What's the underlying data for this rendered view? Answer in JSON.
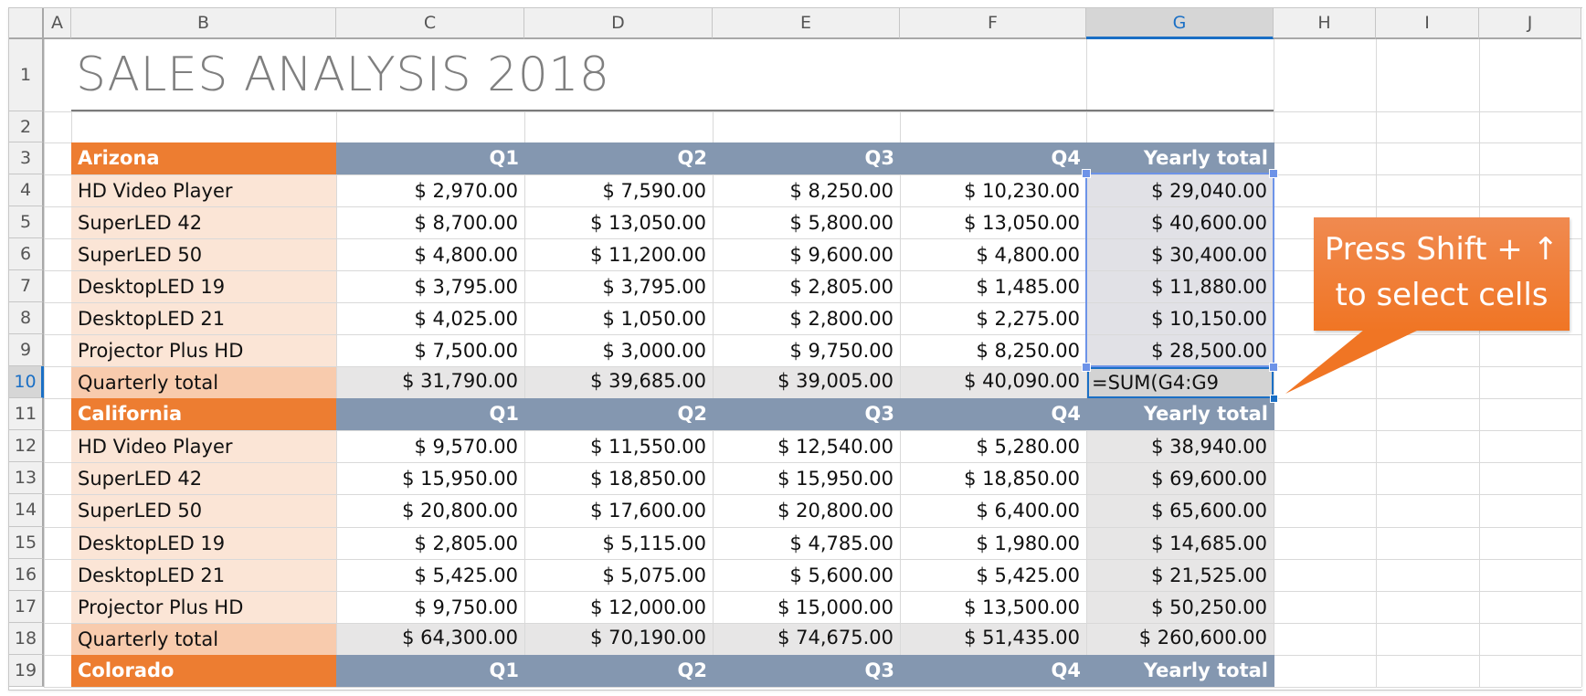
{
  "columns": [
    "A",
    "B",
    "C",
    "D",
    "E",
    "F",
    "G",
    "H",
    "I",
    "J"
  ],
  "selected_column": "G",
  "rows": [
    "1",
    "2",
    "3",
    "4",
    "5",
    "6",
    "7",
    "8",
    "9",
    "10",
    "11",
    "12",
    "13",
    "14",
    "15",
    "16",
    "17",
    "18",
    "19"
  ],
  "selected_row": "10",
  "title": "SALES ANALYSIS 2018",
  "quarter_headers": [
    "Q1",
    "Q2",
    "Q3",
    "Q4",
    "Yearly total"
  ],
  "sections": [
    {
      "state": "Arizona",
      "products": [
        {
          "name": "HD Video Player",
          "values": [
            "$ 2,970.00",
            "$ 7,590.00",
            "$ 8,250.00",
            "$ 10,230.00",
            "$ 29,040.00"
          ]
        },
        {
          "name": "SuperLED 42",
          "values": [
            "$ 8,700.00",
            "$ 13,050.00",
            "$ 5,800.00",
            "$ 13,050.00",
            "$ 40,600.00"
          ]
        },
        {
          "name": "SuperLED 50",
          "values": [
            "$ 4,800.00",
            "$ 11,200.00",
            "$ 9,600.00",
            "$ 4,800.00",
            "$ 30,400.00"
          ]
        },
        {
          "name": "DesktopLED 19",
          "values": [
            "$ 3,795.00",
            "$ 3,795.00",
            "$ 2,805.00",
            "$ 1,485.00",
            "$ 11,880.00"
          ]
        },
        {
          "name": "DesktopLED 21",
          "values": [
            "$ 4,025.00",
            "$ 1,050.00",
            "$ 2,800.00",
            "$ 2,275.00",
            "$ 10,150.00"
          ]
        },
        {
          "name": "Projector Plus HD",
          "values": [
            "$ 7,500.00",
            "$ 3,000.00",
            "$ 9,750.00",
            "$ 8,250.00",
            "$ 28,500.00"
          ]
        }
      ],
      "total_label": "Quarterly total",
      "totals": [
        "$ 31,790.00",
        "$ 39,685.00",
        "$ 39,005.00",
        "$ 40,090.00",
        "=SUM(G4:G9"
      ]
    },
    {
      "state": "California",
      "products": [
        {
          "name": "HD Video Player",
          "values": [
            "$ 9,570.00",
            "$ 11,550.00",
            "$ 12,540.00",
            "$ 5,280.00",
            "$ 38,940.00"
          ]
        },
        {
          "name": "SuperLED 42",
          "values": [
            "$ 15,950.00",
            "$ 18,850.00",
            "$ 15,950.00",
            "$ 18,850.00",
            "$ 69,600.00"
          ]
        },
        {
          "name": "SuperLED 50",
          "values": [
            "$ 20,800.00",
            "$ 17,600.00",
            "$ 20,800.00",
            "$ 6,400.00",
            "$ 65,600.00"
          ]
        },
        {
          "name": "DesktopLED 19",
          "values": [
            "$ 2,805.00",
            "$ 5,115.00",
            "$ 4,785.00",
            "$ 1,980.00",
            "$ 14,685.00"
          ]
        },
        {
          "name": "DesktopLED 21",
          "values": [
            "$ 5,425.00",
            "$ 5,075.00",
            "$ 5,600.00",
            "$ 5,425.00",
            "$ 21,525.00"
          ]
        },
        {
          "name": "Projector Plus HD",
          "values": [
            "$ 9,750.00",
            "$ 12,000.00",
            "$ 15,000.00",
            "$ 13,500.00",
            "$ 50,250.00"
          ]
        }
      ],
      "total_label": "Quarterly total",
      "totals": [
        "$ 64,300.00",
        "$ 70,190.00",
        "$ 74,675.00",
        "$ 51,435.00",
        "$ 260,600.00"
      ]
    },
    {
      "state": "Colorado",
      "products": [],
      "total_label": null,
      "totals": []
    }
  ],
  "active_cell": {
    "ref": "G10",
    "formula": "=SUM(G4:G9"
  },
  "selection_range": "G4:G9",
  "callout": {
    "line1": "Press Shift + ↑",
    "line2": "to select cells"
  },
  "colors": {
    "state_header": "#ed7d31",
    "quarter_header": "#8497b0",
    "product_fill": "#fbe5d6",
    "total_label_fill": "#f8cbad",
    "total_fill": "#e7e6e6",
    "selection": "#6d93e8",
    "active": "#1a6fc5",
    "callout": "#f07524"
  }
}
